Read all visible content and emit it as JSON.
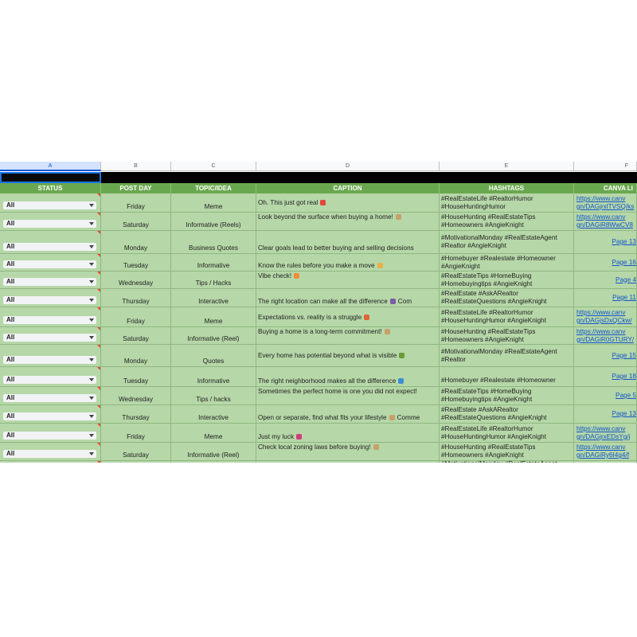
{
  "columns": {
    "letters": [
      "A",
      "B",
      "C",
      "D",
      "E",
      "F"
    ],
    "headers": [
      "STATUS",
      "POST DAY",
      "TOPIC/IDEA",
      "CAPTION",
      "HASHTAGS",
      "CANVA LI"
    ]
  },
  "status_option": "All",
  "colors": {
    "header_green": "#6aa84f",
    "row_green": "#b6d7a8",
    "link_blue": "#1155cc",
    "title_bar": "#000000",
    "note_marker": "#e04a2f"
  },
  "rows": [
    {
      "status": "All",
      "day": "Friday",
      "topic": "Meme",
      "caption": "Oh. This just got real",
      "emoji": "crab-icon",
      "hashtags": [
        "#RealEstateLife #RealtorHumor",
        "#HouseHuntingHumor"
      ],
      "link": [
        "https://www.canv",
        "gn/DAGjrxlTVSQ/ks"
      ]
    },
    {
      "status": "All",
      "day": "Saturday",
      "topic": "Informative (Reels)",
      "caption": "Look beyond the surface when buying a home!",
      "emoji": "house-icon",
      "hashtags": [
        "#HouseHunting #RealEstateTips",
        "#Homeowners #AngieKnight"
      ],
      "link": [
        "https://www.canv",
        "gn/DAGiR8WwCV8"
      ]
    },
    {
      "status": "All",
      "day": "Monday",
      "topic": "Business Quotes",
      "caption": "Clear goals lead to better buying and selling decisions",
      "emoji": "",
      "hashtags": [
        "#MotivationalMonday #RealEstateAgent",
        "#Realtor #AngieKnight"
      ],
      "link": [
        "Page 13"
      ]
    },
    {
      "status": "All",
      "day": "Tuesday",
      "topic": "Informative",
      "caption": "Know the rules before you make a move",
      "emoji": "book-icon",
      "hashtags": [
        "#Homebuyer #Realestate #Homeowner",
        "#AngieKnight"
      ],
      "link": [
        "Page 16"
      ]
    },
    {
      "status": "All",
      "day": "Wednesday",
      "topic": "Tips / Hacks",
      "caption": "Vibe check!",
      "emoji": "sunset-icon",
      "hashtags": [
        "#RealEstateTips #HomeBuying",
        "#Homebuyingtips #AngieKnight"
      ],
      "link": [
        "Page 4"
      ]
    },
    {
      "status": "All",
      "day": "Thursday",
      "topic": "Interactive",
      "caption": "The right location can make all the difference",
      "emoji": "building-tree-icon",
      "caption_suffix": "Com",
      "hashtags": [
        "#RealEstate #AskARealtor",
        "#RealEstateQuestions #AngieKnight"
      ],
      "link": [
        "Page 11"
      ]
    },
    {
      "status": "All",
      "day": "Friday",
      "topic": "Meme",
      "caption": "Expectations vs. reality is a struggle",
      "emoji": "laugh-icon",
      "hashtags": [
        "#RealEstateLife #RealtorHumor",
        "#HouseHuntingHumor #AngieKnight"
      ],
      "link": [
        "https://www.canv",
        "gn/DAGjsDxQCkw/"
      ]
    },
    {
      "status": "All",
      "day": "Saturday",
      "topic": "Informative (Reel)",
      "caption": "Buying a home is a long-term commitment!",
      "emoji": "house-icon",
      "hashtags": [
        "#HouseHunting #RealEstateTips",
        "#Homeowners #AngieKnight"
      ],
      "link": [
        "https://www.canv",
        "gn/DAGiR0GTURY/"
      ]
    },
    {
      "status": "All",
      "day": "Monday",
      "topic": "Quotes",
      "caption": "Every home has potential beyond what is visible",
      "emoji": "plant-icon",
      "hashtags": [
        "#MotivationalMonday #RealEstateAgent",
        "#Realtor"
      ],
      "link": [
        "Page 15"
      ]
    },
    {
      "status": "All",
      "day": "Tuesday",
      "topic": "Informative",
      "caption": "The right neighborhood makes all the difference",
      "emoji": "globe-icon",
      "hashtags": [
        "#Homebuyer #Realestate #Homeowner"
      ],
      "link": [
        "Page 18"
      ]
    },
    {
      "status": "All",
      "day": "Wednesday",
      "topic": "Tips / hacks",
      "caption": "Sometimes the perfect home is one you did not expect!",
      "emoji": "",
      "hashtags": [
        "#RealEstateTips #HomeBuying",
        "#Homebuyingtips #AngieKnight"
      ],
      "link": [
        "Page 5"
      ]
    },
    {
      "status": "All",
      "day": "Thursday",
      "topic": "Interactive",
      "caption": "Open or separate, find what fits your lifestyle",
      "emoji": "house-icon",
      "caption_suffix": "Comme",
      "hashtags": [
        "#RealEstate #AskARealtor",
        "#RealEstateQuestions #AngieKnight"
      ],
      "link": [
        "Page 13"
      ]
    },
    {
      "status": "All",
      "day": "Friday",
      "topic": "Meme",
      "caption": "Just my luck",
      "emoji": "dice-icon",
      "hashtags": [
        "#RealEstateLife #RealtorHumor",
        "#HouseHuntingHumor #AngieKnight"
      ],
      "link": [
        "https://www.canv",
        "gn/DAGjrxEDsYg/j"
      ]
    },
    {
      "status": "All",
      "day": "Saturday",
      "topic": "Informative (Reel)",
      "caption": "Check local zoning laws before buying!",
      "emoji": "house-icon",
      "hashtags": [
        "#HouseHunting #RealEstateTips",
        "#Homeowners #AngieKnight"
      ],
      "link": [
        "https://www.canv",
        "gn/DAGiRy6I4g4/f"
      ]
    }
  ],
  "partial_row": {
    "hashtags": [
      "#MotivationalMonday #RealEstateAgent"
    ]
  }
}
